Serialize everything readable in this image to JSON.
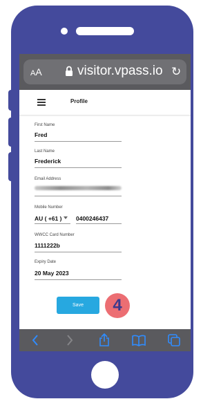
{
  "browser": {
    "text_size_label": "AA",
    "domain": "visitor.vpass.io",
    "toolbar": {
      "back_icon": "chevron-left-icon",
      "forward_icon": "chevron-right-icon",
      "share_icon": "share-icon",
      "bookmarks_icon": "book-icon",
      "tabs_icon": "tabs-icon"
    }
  },
  "app": {
    "title": "Profile"
  },
  "form": {
    "first_name": {
      "label": "First Name",
      "value": "Fred"
    },
    "last_name": {
      "label": "Last Name",
      "value": "Frederick"
    },
    "email": {
      "label": "Email Address"
    },
    "mobile": {
      "label": "Mobile Number",
      "country_code": "AU ( +61 )",
      "number": "0400246437"
    },
    "wwcc": {
      "label": "WWCC Card Number",
      "value": "1111222b"
    },
    "expiry": {
      "label": "Expiry Date",
      "value": "20 May 2023"
    },
    "save_label": "Save"
  },
  "step_badge": "4",
  "colors": {
    "phone": "#444a9c",
    "save_button": "#27a8e0",
    "badge": "#ec6e73",
    "badge_text": "#3c3a8c",
    "browser_chrome": "#5a5a5e"
  }
}
